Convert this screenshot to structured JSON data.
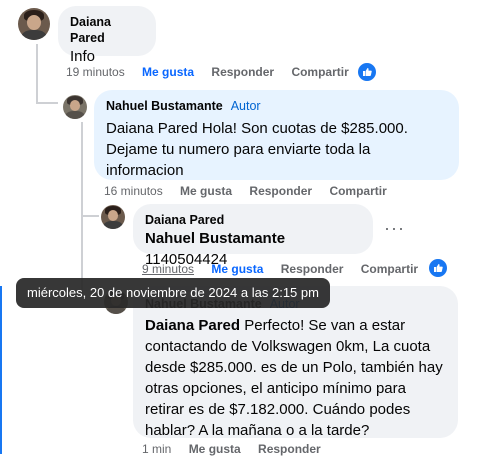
{
  "comments": [
    {
      "author": "Daiana Pared",
      "text": "Info",
      "time": "19 minutos",
      "liked_label": "Me gusta",
      "reply_label": "Responder",
      "share_label": "Compartir"
    },
    {
      "author": "Nahuel Bustamante",
      "badge": "Autor",
      "text": "Daiana Pared Hola! Son cuotas de $285.000. Dejame tu numero para enviarte toda la informacion",
      "time": "16 minutos",
      "like_label": "Me gusta",
      "reply_label": "Responder",
      "share_label": "Compartir"
    },
    {
      "author": "Daiana Pared",
      "mention": "Nahuel Bustamante",
      "text": "1140504424",
      "time": "9 minutos",
      "liked_label": "Me gusta",
      "reply_label": "Responder",
      "share_label": "Compartir"
    },
    {
      "author": "Nahuel Bustamante",
      "badge": "Autor",
      "mention": "Daiana Pared",
      "text": "Perfecto! Se van a estar contactando de Volkswagen 0km, La cuota desde $285.000. es de un Polo, también hay otras opciones, el anticipo mínimo para retirar es de $7.182.000. Cuándo podes hablar? A la mañana o a la tarde?",
      "time": "1 min",
      "like_label": "Me gusta",
      "reply_label": "Responder"
    }
  ],
  "tooltip": "miércoles, 20 de noviembre de 2024 a las 2:15 pm",
  "more_options": "···",
  "colors": {
    "like_blue": "#1877f2",
    "link_blue": "#0866ff",
    "author_badge": "#0064d1"
  },
  "icons": [
    "like-thumb-icon",
    "more-options-icon"
  ]
}
